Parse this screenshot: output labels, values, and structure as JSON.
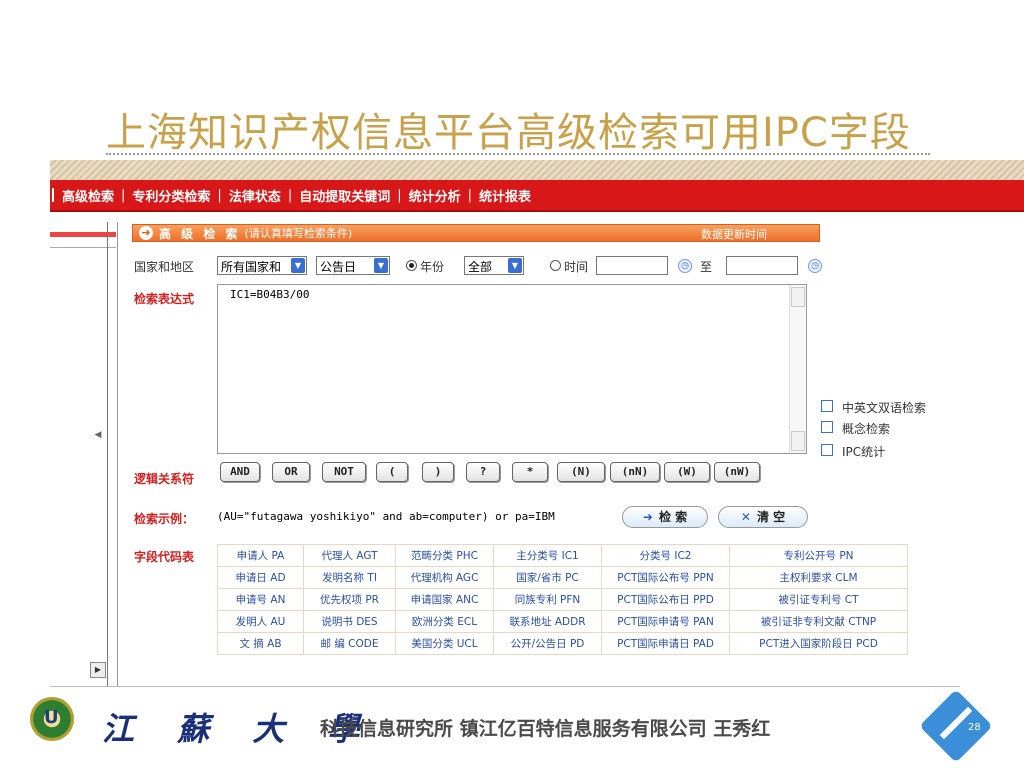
{
  "slide": {
    "title": "上海知识产权信息平台高级检索可用IPC字段",
    "page_number": "28",
    "university": "江 蘇 大 學",
    "footer": "科技信息研究所 镇江亿百特信息服务有限公司 王秀红"
  },
  "nav": {
    "items": [
      "高级检索",
      "专利分类检索",
      "法律状态",
      "自动提取关键词",
      "统计分析",
      "统计报表"
    ]
  },
  "panel": {
    "title": "高 级 检 索",
    "subtitle": "(请认真填写检索条件)",
    "update_label": "数据更新时间"
  },
  "form": {
    "country_label": "国家和地区",
    "country_value": "所有国家和",
    "doc_type_value": "公告日",
    "radio_year_label": "年份",
    "year_value": "全部",
    "radio_time_label": "时间",
    "to_label": "至",
    "expression_label": "检索表达式",
    "expression_value": "IC1=B04B3/00",
    "logic_label": "逻辑关系符",
    "example_label": "检索示例：",
    "example_value": "(AU=\"futagawa yoshikiyo\" and ab=computer) or pa=IBM",
    "search_button": "检 索",
    "clear_button": "清 空",
    "field_code_label": "字段代码表"
  },
  "options": [
    "中英文双语检索",
    "概念检索",
    "IPC统计"
  ],
  "operators": [
    "AND",
    "OR",
    "NOT",
    "(",
    ")",
    "?",
    "*",
    "(N)",
    "(nN)",
    "(W)",
    "(nW)"
  ],
  "field_codes": [
    [
      "申请人 PA",
      "代理人 AGT",
      "范畴分类 PHC",
      "主分类号 IC1",
      "分类号 IC2",
      "专利公开号 PN"
    ],
    [
      "申请日 AD",
      "发明名称 TI",
      "代理机构 AGC",
      "国家/省市 PC",
      "PCT国际公布号 PPN",
      "主权利要求 CLM"
    ],
    [
      "申请号 AN",
      "优先权项 PR",
      "申请国家 ANC",
      "同族专利 PFN",
      "PCT国际公布日 PPD",
      "被引证专利号 CT"
    ],
    [
      "发明人 AU",
      "说明书 DES",
      "欧洲分类 ECL",
      "联系地址 ADDR",
      "PCT国际申请号 PAN",
      "被引证非专利文献 CTNP"
    ],
    [
      "文 摘 AB",
      "邮 编 CODE",
      "美国分类 UCL",
      "公开/公告日 PD",
      "PCT国际申请日 PAD",
      "PCT进入国家阶段日 PCD"
    ]
  ],
  "colors": {
    "title": "#c8a24a",
    "nav_bar": "#d81818",
    "panel_header": "#ee6f2a",
    "label_red": "#d02020",
    "code_link": "#2c4fa0"
  }
}
